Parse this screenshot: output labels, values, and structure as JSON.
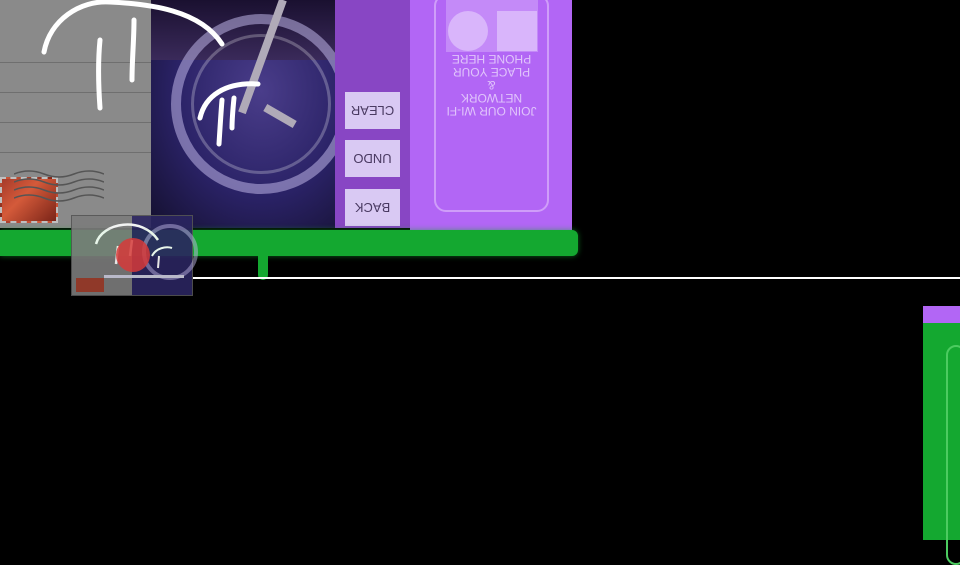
{
  "controls": {
    "back_label": "BACK",
    "undo_label": "UNDO",
    "clear_label": "CLEAR"
  },
  "nfc_panel": {
    "lines": [
      "JOIN OUR WI-FI",
      "NETWORK",
      "&",
      "PLACE YOUR",
      "PHONE HERE"
    ]
  },
  "colors": {
    "controls_bg": "#8846c4",
    "panel_bg": "#b266f5",
    "button_bg": "#d9c9f3",
    "green_accent": "#14a830"
  },
  "icons": {
    "circle_shape": "circle-icon",
    "square_shape": "square-icon"
  }
}
